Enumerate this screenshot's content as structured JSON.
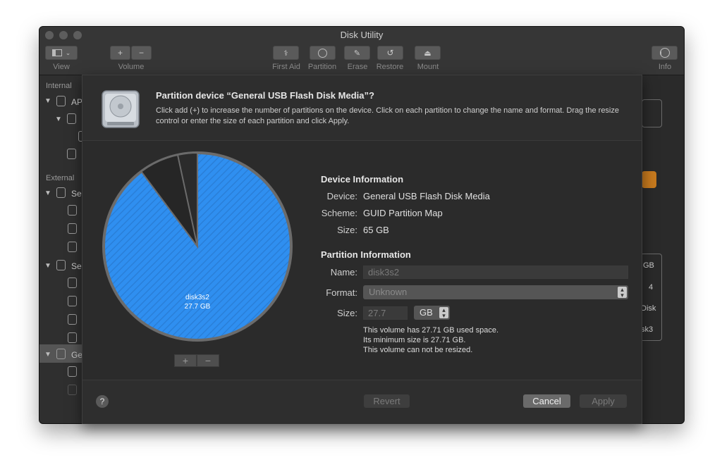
{
  "window": {
    "title": "Disk Utility"
  },
  "toolbar": {
    "view_label": "View",
    "volume_label": "Volume",
    "first_aid_label": "First Aid",
    "partition_label": "Partition",
    "erase_label": "Erase",
    "restore_label": "Restore",
    "mount_label": "Mount",
    "info_label": "Info"
  },
  "sidebar": {
    "internal_header": "Internal",
    "external_header": "External",
    "rows": [
      "AP",
      "Se",
      "Se",
      "Ge"
    ]
  },
  "right_fragments": [
    "GB",
    "4",
    "Disk",
    "sk3"
  ],
  "sheet": {
    "title": "Partition device “General USB Flash Disk Media”?",
    "description": "Click add (+) to increase the number of partitions on the device. Click on each partition to change the name and format. Drag the resize control or enter the size of each partition and click Apply.",
    "pie": {
      "name": "disk3s2",
      "size": "27.7 GB"
    },
    "add_label": "+",
    "remove_label": "−",
    "device_info": {
      "heading": "Device Information",
      "device_label": "Device:",
      "device_value": "General USB Flash Disk Media",
      "scheme_label": "Scheme:",
      "scheme_value": "GUID Partition Map",
      "size_label": "Size:",
      "size_value": "65 GB"
    },
    "partition_info": {
      "heading": "Partition Information",
      "name_label": "Name:",
      "name_value": "disk3s2",
      "format_label": "Format:",
      "format_value": "Unknown",
      "size_label": "Size:",
      "size_value": "27.7",
      "unit_value": "GB",
      "notes": [
        "This volume has 27.71 GB used space.",
        "Its minimum size is 27.71 GB.",
        "This volume can not be resized."
      ]
    },
    "help_label": "?",
    "revert_label": "Revert",
    "cancel_label": "Cancel",
    "apply_label": "Apply"
  }
}
